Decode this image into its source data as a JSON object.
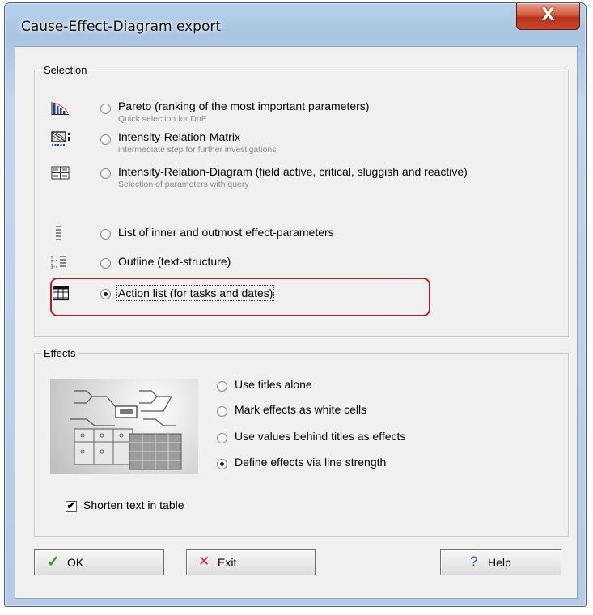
{
  "window": {
    "title": "Cause-Effect-Diagram export",
    "close_label": "X"
  },
  "selection": {
    "legend": "Selection",
    "options": [
      {
        "label": "Pareto (ranking of the most important parameters)",
        "sublabel": "Quick selection for DoE",
        "icon": "pareto-chart-icon",
        "checked": false
      },
      {
        "label": "Intensity-Relation-Matrix",
        "sublabel": "intermediate step for further investigations",
        "icon": "matrix-icon",
        "checked": false
      },
      {
        "label": "Intensity-Relation-Diagram (field active, critical, sluggish and reactive)",
        "sublabel": "Selection of parameters with query",
        "icon": "quadrant-diagram-icon",
        "checked": false
      },
      {
        "label": "List of inner and outmost effect-parameters",
        "sublabel": "",
        "icon": "list-icon",
        "checked": false
      },
      {
        "label": "Outline (text-structure)",
        "sublabel": "",
        "icon": "outline-icon",
        "checked": false
      },
      {
        "label": "Action list (for tasks and dates)",
        "sublabel": "",
        "icon": "table-icon",
        "checked": true
      }
    ]
  },
  "effects": {
    "legend": "Effects",
    "options": [
      {
        "label": "Use titles alone",
        "checked": false
      },
      {
        "label": "Mark effects as white cells",
        "checked": false
      },
      {
        "label": "Use values behind titles as effects",
        "checked": false
      },
      {
        "label": "Define effects via line strength",
        "checked": true
      }
    ],
    "shorten_label": "Shorten text in table",
    "shorten_checked": true,
    "shorten_check_glyph": "✔"
  },
  "buttons": {
    "ok_label": "OK",
    "ok_glyph": "✓",
    "exit_label": "Exit",
    "exit_glyph": "✕",
    "help_label": "Help",
    "help_glyph": "?"
  },
  "colors": {
    "highlight": "#b01e24",
    "ok_check": "#2f9a2f",
    "exit_x": "#d42020",
    "help_q": "#1f5fb8"
  }
}
